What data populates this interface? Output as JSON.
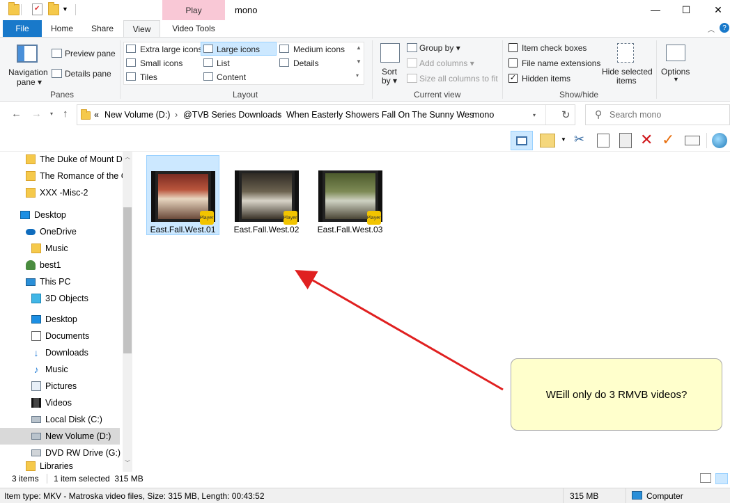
{
  "window": {
    "title": "mono",
    "context_tab": "Play",
    "controls": {
      "minimize": "—",
      "maximize": "☐",
      "close": "✕"
    }
  },
  "ribbon_tabs": [
    "File",
    "Home",
    "Share",
    "View",
    "Video Tools"
  ],
  "ribbon": {
    "panes": {
      "navigation_pane": "Navigation",
      "navigation_pane2": "pane",
      "preview_pane": "Preview pane",
      "details_pane": "Details pane",
      "label": "Panes"
    },
    "layout": {
      "items": [
        "Extra large icons",
        "Large icons",
        "Medium icons",
        "Small icons",
        "List",
        "Details",
        "Tiles",
        "Content"
      ],
      "selected": "Large icons",
      "label": "Layout"
    },
    "current_view": {
      "sort_by": "Sort",
      "sort_by2": "by",
      "group_by": "Group by",
      "add_columns": "Add columns",
      "size_columns": "Size all columns to fit",
      "label": "Current view"
    },
    "show_hide": {
      "item_check_boxes": "Item check boxes",
      "file_name_extensions": "File name extensions",
      "hidden_items": "Hidden items",
      "hide_selected": "Hide selected",
      "hide_selected2": "items",
      "label": "Show/hide"
    },
    "options": "Options"
  },
  "address": {
    "crumbs": [
      "New Volume (D:)",
      "@TVB Series Downloads",
      "When Easterly Showers Fall On The Sunny Wes",
      "mono"
    ],
    "overflow": "«",
    "search_placeholder": "Search mono"
  },
  "nav_pane": [
    {
      "label": "The Duke of Mount De",
      "icon": "folder-icon"
    },
    {
      "label": "The Romance of the C",
      "icon": "folder-icon"
    },
    {
      "label": "XXX -Misc-2",
      "icon": "folder-icon"
    },
    {
      "label": "Desktop",
      "icon": "desktop-icon"
    },
    {
      "label": "OneDrive",
      "icon": "cloud-icon"
    },
    {
      "label": "Music",
      "icon": "folder-icon"
    },
    {
      "label": "best1",
      "icon": "user-icon"
    },
    {
      "label": "This PC",
      "icon": "computer-icon"
    },
    {
      "label": "3D Objects",
      "icon": "cube-icon"
    },
    {
      "label": "Desktop",
      "icon": "desktop-icon"
    },
    {
      "label": "Documents",
      "icon": "documents-icon"
    },
    {
      "label": "Downloads",
      "icon": "download-icon"
    },
    {
      "label": "Music",
      "icon": "music-icon"
    },
    {
      "label": "Pictures",
      "icon": "pictures-icon"
    },
    {
      "label": "Videos",
      "icon": "videos-icon"
    },
    {
      "label": "Local Disk (C:)",
      "icon": "drive-icon"
    },
    {
      "label": "New Volume (D:)",
      "icon": "drive-icon"
    },
    {
      "label": "DVD RW Drive (G:)",
      "icon": "dvd-icon"
    },
    {
      "label": "Libraries",
      "icon": "folder-icon"
    }
  ],
  "files": [
    {
      "name": "East.Fall.West.01",
      "selected": true
    },
    {
      "name": "East.Fall.West.02",
      "selected": false
    },
    {
      "name": "East.Fall.West.03",
      "selected": false
    }
  ],
  "player_badge": "Player",
  "callout": "WEill only do 3 RMVB videos?",
  "status": {
    "count": "3 items",
    "selected": "1 item selected  315 MB"
  },
  "infobar": {
    "details": "Item type: MKV - Matroska video files, Size: 315 MB, Length: 00:43:52",
    "size": "315 MB",
    "location": "Computer"
  },
  "colors": {
    "accent": "#1979ca",
    "selection": "#cce8ff",
    "arrow": "#e02020",
    "callout": "#ffffcc"
  }
}
